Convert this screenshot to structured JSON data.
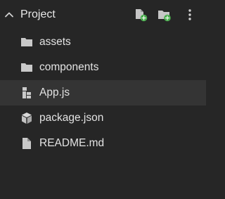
{
  "header": {
    "title": "Project"
  },
  "tree": {
    "items": [
      {
        "label": "assets",
        "icon": "folder-icon"
      },
      {
        "label": "components",
        "icon": "folder-icon"
      },
      {
        "label": "App.js",
        "icon": "javascript-file-icon",
        "selected": true
      },
      {
        "label": "package.json",
        "icon": "package-icon"
      },
      {
        "label": "README.md",
        "icon": "file-icon"
      }
    ]
  },
  "colors": {
    "background": "#262626",
    "selected_row": "#343434",
    "text": "#e3e3e3",
    "icon": "#c9c9c9",
    "accent_plus": "#4caf50"
  }
}
